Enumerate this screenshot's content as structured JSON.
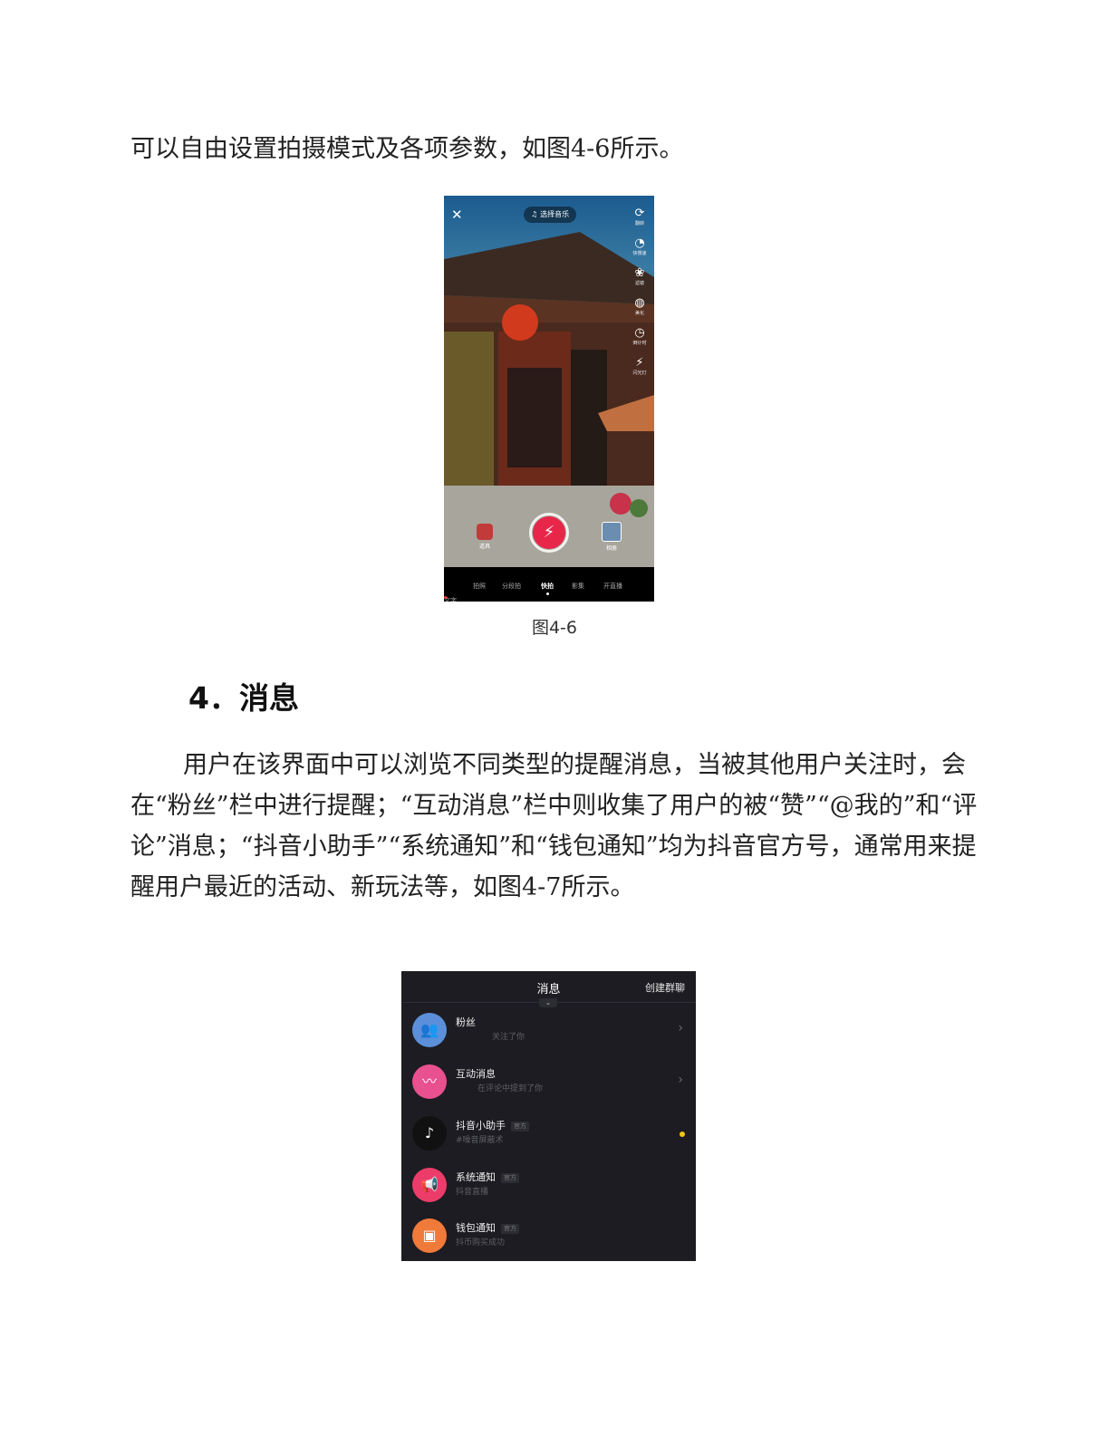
{
  "paragraph1": "可以自由设置拍摄模式及各项参数，如图4-6所示。",
  "figure1": {
    "caption": "图4-6",
    "close_icon": "close-icon",
    "music_label": "选择音乐",
    "side_tools": [
      {
        "icon": "flip-camera-icon",
        "glyph": "⟳",
        "label": "翻转"
      },
      {
        "icon": "speed-icon",
        "glyph": "◔",
        "label": "快慢速"
      },
      {
        "icon": "filter-icon",
        "glyph": "❀",
        "label": "滤镜"
      },
      {
        "icon": "beauty-icon",
        "glyph": "◍",
        "label": "美化"
      },
      {
        "icon": "timer-icon",
        "glyph": "◷",
        "label": "倒计时"
      },
      {
        "icon": "flash-off-icon",
        "glyph": "⚡",
        "label": "闪光灯"
      }
    ],
    "effects_label": "道具",
    "upload_label": "相册",
    "shutter_icon": "lightning-icon",
    "modes": [
      "文字",
      "拍照",
      "分段拍",
      "快拍",
      "影集",
      "开直播"
    ],
    "active_mode": "快拍"
  },
  "heading": "4．消息",
  "paragraph2": "用户在该界面中可以浏览不同类型的提醒消息，当被其他用户关注时，会在“粉丝”栏中进行提醒；“互动消息”栏中则收集了用户的被“赞”“@我的”和“评论”消息；“抖音小助手”“系统通知”和“钱包通知”均为抖音官方号，通常用来提醒用户最近的活动、新玩法等，如图4-7所示。",
  "figure2": {
    "title": "消息",
    "create_group": "创建群聊",
    "rows": [
      {
        "title": "粉丝",
        "subtitle": "关注了你",
        "badge": "",
        "icon": "fans-icon",
        "color": "#5b8fd9",
        "arrow": true,
        "unread": false
      },
      {
        "title": "互动消息",
        "subtitle": "在评论中提到了你",
        "badge": "",
        "icon": "interaction-icon",
        "color": "#e8508f",
        "arrow": true,
        "unread": false
      },
      {
        "title": "抖音小助手",
        "subtitle": "#噪音屏蔽术",
        "badge": "官方",
        "icon": "tiktok-icon",
        "color": "#111111",
        "arrow": false,
        "unread": true
      },
      {
        "title": "系统通知",
        "subtitle": "抖音直播",
        "badge": "官方",
        "icon": "megaphone-icon",
        "color": "#ec3c6a",
        "arrow": false,
        "unread": false
      },
      {
        "title": "钱包通知",
        "subtitle": "抖币购买成功",
        "badge": "官方",
        "icon": "wallet-icon",
        "color": "#f07a3a",
        "arrow": false,
        "unread": false
      }
    ]
  }
}
